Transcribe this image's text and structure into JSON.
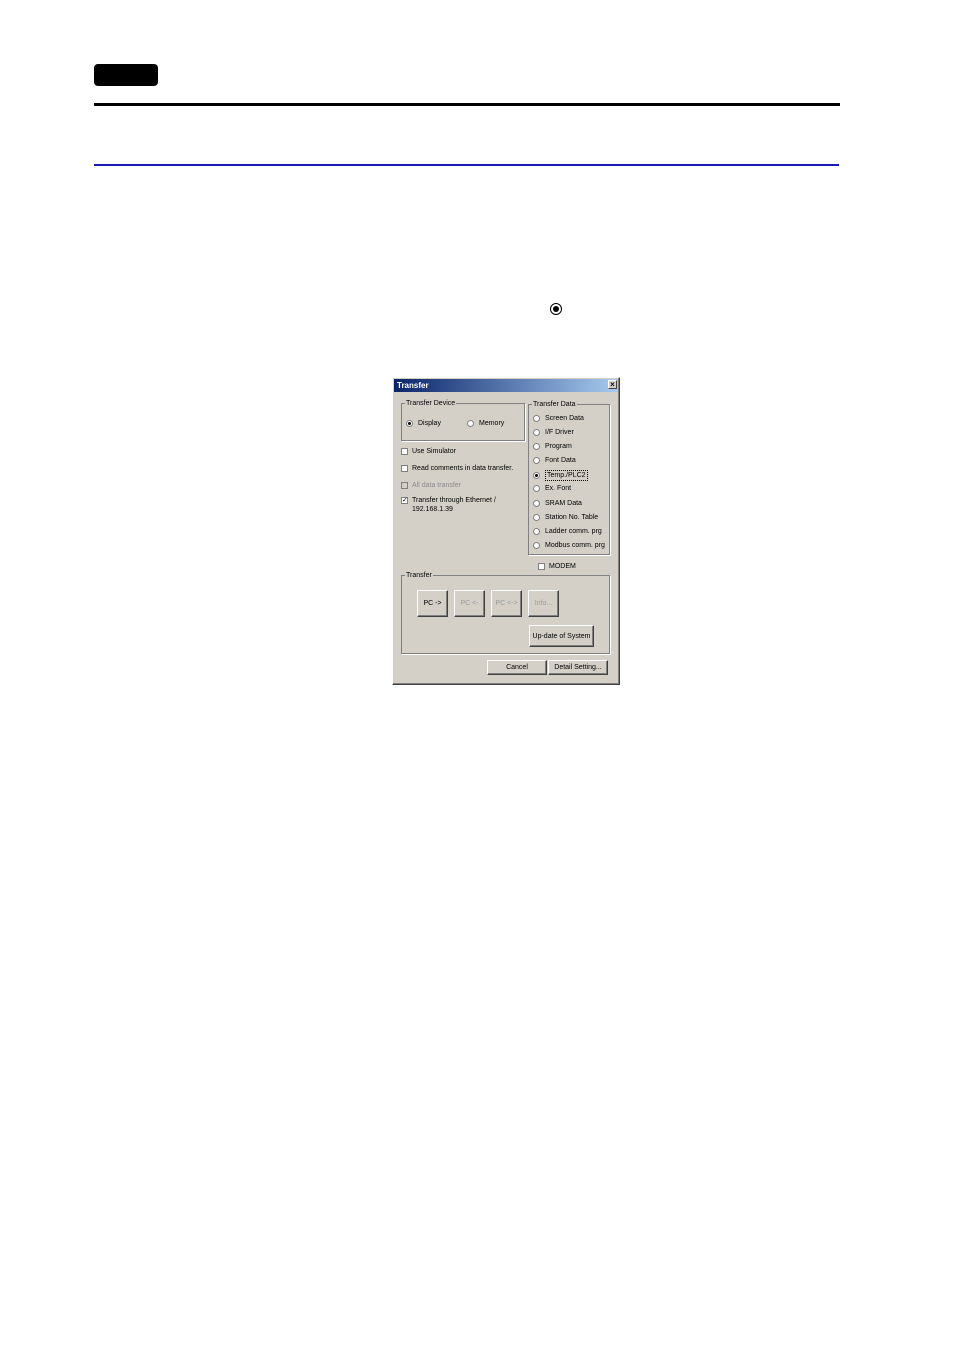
{
  "dialog": {
    "title": "Transfer",
    "close_glyph": "×",
    "transfer_device": {
      "legend": "Transfer Device",
      "options": [
        "Display",
        "Memory"
      ],
      "selected": "Display"
    },
    "checkboxes": {
      "use_simulator": "Use Simulator",
      "read_comments": "Read comments in data transfer.",
      "all_data_transfer": "All data transfer",
      "ethernet_line1": "Transfer through Ethernet /",
      "ethernet_line2": "192.168.1.39",
      "modem": "MODEM"
    },
    "check_mark": "✓",
    "transfer_data": {
      "legend": "Transfer Data",
      "options": [
        "Screen Data",
        "I/F Driver",
        "Program",
        "Font Data",
        "Temp./PLC2",
        "Ex. Font",
        "SRAM Data",
        "Station No. Table",
        "Ladder comm. prg",
        "Modbus comm. prg"
      ],
      "selected": "Temp./PLC2"
    },
    "transfer_group": {
      "legend": "Transfer",
      "buttons": [
        "PC ->",
        "PC <-",
        "PC <->",
        "Info..."
      ],
      "update_system": "Up-date of System"
    },
    "footer": {
      "cancel": "Cancel",
      "detail_setting": "Detail Setting..."
    }
  }
}
